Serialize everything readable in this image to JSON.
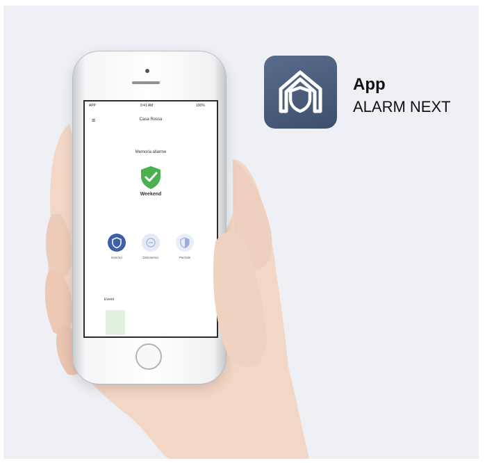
{
  "badge": {
    "title": "App",
    "subtitle": "ALARM NEXT",
    "icon": "shield-house-icon",
    "icon_bg": "#4a5b7a"
  },
  "phone_screen": {
    "status_left": "APP",
    "status_time": "9:41 AM",
    "status_right": "100%",
    "nav_title": "Casa Rossa",
    "memory_title": "Memoria allarme",
    "status_word": "Weekend",
    "modes": [
      {
        "label": "Inserisci",
        "icon": "shield-icon",
        "active": true
      },
      {
        "label": "Disinserisci",
        "icon": "unlock-icon",
        "active": false
      },
      {
        "label": "Parziale",
        "icon": "half-shield-icon",
        "active": false
      }
    ],
    "history_title": "Eventi",
    "accent": "#3d5fa8",
    "ok_color": "#4caf50"
  }
}
